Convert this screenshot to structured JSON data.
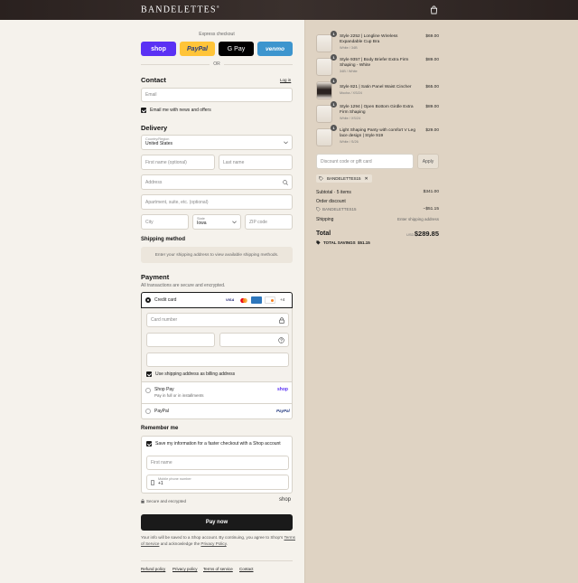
{
  "header": {
    "brand": "BANDELETTES",
    "brand_mark": "®"
  },
  "express": {
    "label": "Express checkout",
    "buttons": [
      {
        "label": "shop",
        "color": "#5a31f4"
      },
      {
        "label": "PayPal",
        "color": "#ffc439"
      },
      {
        "label": "G Pay",
        "color": "#000000"
      },
      {
        "label": "venmo",
        "color": "#3d95ce"
      }
    ],
    "or": "OR"
  },
  "contact": {
    "heading": "Contact",
    "login": "Log in",
    "email_placeholder": "Email",
    "news_label": "Email me with news and offers"
  },
  "delivery": {
    "heading": "Delivery",
    "country_label": "Country/Region",
    "country_value": "United States",
    "first_name": "First name (optional)",
    "last_name": "Last name",
    "address": "Address",
    "apartment": "Apartment, suite, etc. (optional)",
    "city": "City",
    "state_label": "State",
    "state_value": "Iowa",
    "zip": "ZIP code"
  },
  "shipping": {
    "heading": "Shipping method",
    "note": "Enter your shipping address to view available shipping methods."
  },
  "payment": {
    "heading": "Payment",
    "note": "All transactions are secure and encrypted.",
    "credit_card": "Credit card",
    "card_more": "+4",
    "card_number": "Card number",
    "billing_label": "Use shipping address as billing address",
    "shoppay_label": "Shop Pay",
    "shoppay_sub": "Pay in full or in installments",
    "shoppay_logo": "shop",
    "paypal_label": "PayPal",
    "paypal_logo": "PayPal"
  },
  "remember": {
    "heading": "Remember me",
    "save_label": "Save my information for a faster checkout with a Shop account",
    "first_name": "First name",
    "phone_label": "Mobile phone number",
    "phone_value": "+1",
    "secure": "Secure and encrypted",
    "shop_logo": "shop"
  },
  "pay_now": "Pay now",
  "disclaimer": {
    "line1": "Your info will be saved to a Shop account. By continuing, you agree to Shop's",
    "terms": "Terms of Service",
    "mid": "and acknowledge the",
    "privacy": "Privacy Policy",
    "end": "."
  },
  "footer_links": [
    "Refund policy",
    "Privacy policy",
    "Terms of service",
    "Contact"
  ],
  "cart": {
    "items": [
      {
        "qty": "1",
        "name": "Style 2252 | Longline Wireless Expandable Cup Bra",
        "variant": "White / 34B",
        "price": "$69.00"
      },
      {
        "qty": "1",
        "name": "Style 9357 | Body Briefer Extra Firm Shaping - White",
        "variant": "34B / White",
        "price": "$89.00"
      },
      {
        "qty": "1",
        "name": "Style 821 | Satin Panel Waist Cincher",
        "variant": "Mocha / XS/24",
        "price": "$65.00"
      },
      {
        "qty": "1",
        "name": "Style 1294 | Open Bottom Girdle Extra Firm Shaping",
        "variant": "White / XS/24",
        "price": "$89.00"
      },
      {
        "qty": "1",
        "name": "Light Shaping Panty with comfort V Leg lace design | Style 919",
        "variant": "White / S/26",
        "price": "$29.00"
      }
    ],
    "discount_placeholder": "Discount code or gift card",
    "apply": "Apply",
    "code_tag": "BANDELETTES15",
    "subtotal_label": "Subtotal · 5 items",
    "subtotal_value": "$341.00",
    "order_discount_label": "Order discount",
    "discount_code": "BANDELETTES15",
    "discount_value": "−$51.15",
    "shipping_label": "Shipping",
    "shipping_value": "Enter shipping address",
    "total_label": "Total",
    "currency": "USD",
    "total_value": "$289.85",
    "savings_label": "TOTAL SAVINGS",
    "savings_value": "$51.15"
  }
}
